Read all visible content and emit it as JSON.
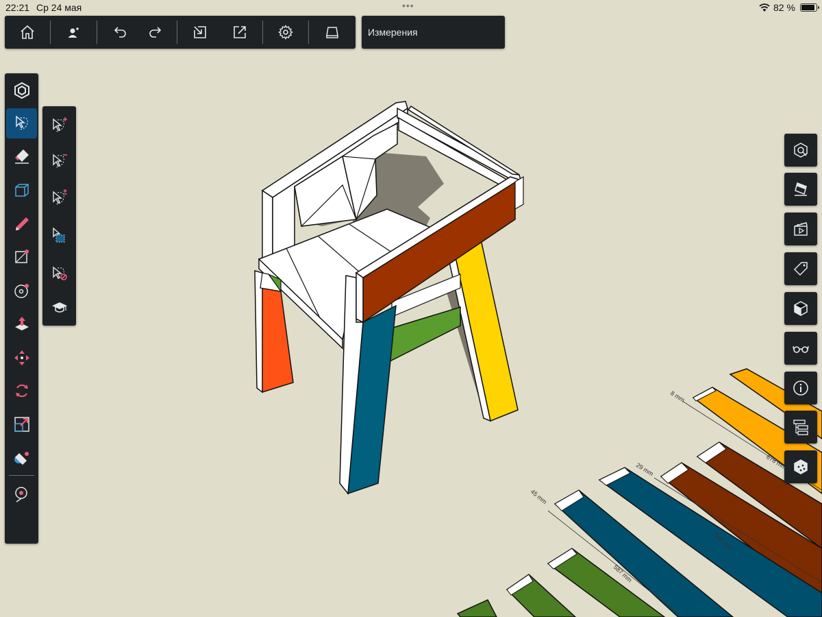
{
  "status_bar": {
    "time": "22:21",
    "date": "Ср 24 мая",
    "multitask_dots": "•••",
    "battery_text": "82 %",
    "battery_level": 0.82,
    "wifi_icon": "wifi-icon"
  },
  "top_toolbar": {
    "buttons": [
      "home-icon",
      "add-user-icon",
      "undo-icon",
      "redo-icon",
      "import-icon",
      "export-icon",
      "settings-icon",
      "tray-icon"
    ]
  },
  "panel_title": "Измерения",
  "left_toolbar": {
    "tools": [
      "select-tool-icon",
      "lasso-select-icon",
      "eraser-icon",
      "box-tool-icon",
      "pencil-icon",
      "rectangle-tool-icon",
      "circle-tool-icon",
      "push-pull-icon",
      "move-icon",
      "rotate-icon",
      "scale-icon",
      "paint-bucket-icon",
      "tape-measure-icon"
    ],
    "active_tool": "lasso-select-icon",
    "more_label": "···"
  },
  "selection_flyout": {
    "options": [
      "add-to-selection-icon",
      "subtract-from-selection-icon",
      "toggle-selection-icon",
      "select-all-icon",
      "deselect-icon",
      "tutorial-icon"
    ]
  },
  "right_toolbar": {
    "buttons": [
      "components-icon",
      "materials-icon",
      "scenes-icon",
      "tags-icon",
      "views-icon",
      "display-icon",
      "entity-info-icon",
      "outliner-icon",
      "model-info-icon"
    ]
  },
  "model_colors": {
    "leg_front_left": "#ff5216",
    "leg_front_right": "#00607e",
    "leg_back_right": "#ffd400",
    "stretcher": "#5b9c2f",
    "armrest": "#9b3200",
    "parts_orange": "#ffaa00",
    "parts_brown": "#7d2b00",
    "parts_blue": "#004f6c",
    "parts_green": "#4b7d23"
  },
  "dimensions": {
    "d1": "8 mm",
    "d2": "678 mm",
    "d3": "29 mm",
    "d4": "505 mm",
    "d5": "45 mm",
    "d6": "587 mm"
  }
}
